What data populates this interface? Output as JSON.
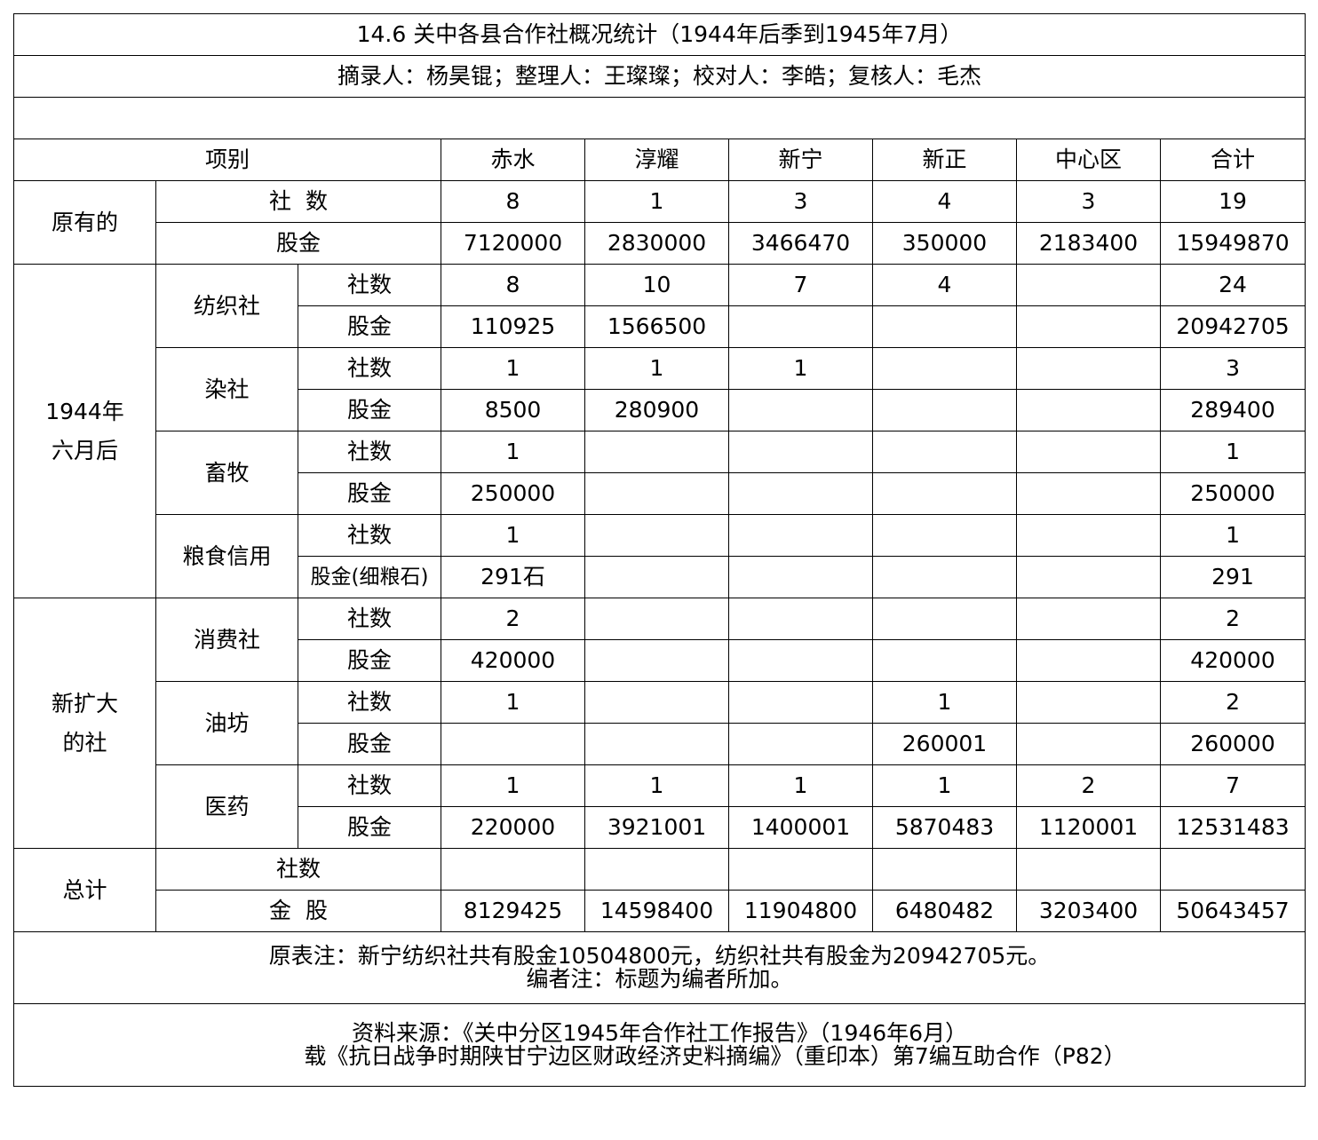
{
  "title": "14.6 关中各县合作社概况统计（1944年后季到1945年7月）",
  "credits": "摘录人：杨昊锟；整理人：王璨璨；校对人：李皓；复核人：毛杰",
  "header": {
    "item": "项别",
    "columns": [
      "赤水",
      "淳耀",
      "新宁",
      "新正",
      "中心区",
      "合计"
    ]
  },
  "groups": {
    "original": "原有的",
    "after1944": "1944年六月后",
    "new": "新扩大的社",
    "total": "总计"
  },
  "subgroups": {
    "textile": "纺织社",
    "dye": "染社",
    "livestock": "畜牧",
    "grain": "粮食信用",
    "consumer": "消费社",
    "oil": "油坊",
    "medicine": "医药"
  },
  "labels": {
    "count_spaced": "社  数",
    "count": "社数",
    "shares": "股金",
    "shares_grain": "股金(细粮石)",
    "shares_spaced": "金  股"
  },
  "rows": {
    "original_count": [
      "8",
      "1",
      "3",
      "4",
      "3",
      "19"
    ],
    "original_shares": [
      "7120000",
      "2830000",
      "3466470",
      "350000",
      "2183400",
      "15949870"
    ],
    "textile_count": [
      "8",
      "10",
      "7",
      "4",
      "",
      "24"
    ],
    "textile_shares": [
      "110925",
      "1566500",
      "",
      "",
      "",
      "20942705"
    ],
    "dye_count": [
      "1",
      "1",
      "1",
      "",
      "",
      "3"
    ],
    "dye_shares": [
      "8500",
      "280900",
      "",
      "",
      "",
      "289400"
    ],
    "livestock_count": [
      "1",
      "",
      "",
      "",
      "",
      "1"
    ],
    "livestock_shares": [
      "250000",
      "",
      "",
      "",
      "",
      "250000"
    ],
    "grain_count": [
      "1",
      "",
      "",
      "",
      "",
      "1"
    ],
    "grain_shares": [
      "291石",
      "",
      "",
      "",
      "",
      "291"
    ],
    "consumer_count": [
      "2",
      "",
      "",
      "",
      "",
      "2"
    ],
    "consumer_shares": [
      "420000",
      "",
      "",
      "",
      "",
      "420000"
    ],
    "oil_count": [
      "1",
      "",
      "",
      "1",
      "",
      "2"
    ],
    "oil_shares": [
      "",
      "",
      "",
      "260001",
      "",
      "260000"
    ],
    "medicine_count": [
      "1",
      "1",
      "1",
      "1",
      "2",
      "7"
    ],
    "medicine_shares": [
      "220000",
      "3921001",
      "1400001",
      "5870483",
      "1120001",
      "12531483"
    ],
    "total_count": [
      "",
      "",
      "",
      "",
      "",
      ""
    ],
    "total_shares": [
      "8129425",
      "14598400",
      "11904800",
      "6480482",
      "3203400",
      "50643457"
    ]
  },
  "notes": {
    "original_note": "原表注：新宁纺织社共有股金10504800元，纺织社共有股金为20942705元。",
    "editor_note": "编者注：标题为编者所加。"
  },
  "source": {
    "line1": "资料来源：《关中分区1945年合作社工作报告》（1946年6月）",
    "line2": "载《抗日战争时期陕甘宁边区财政经济史料摘编》（重印本）第7编互助合作（P82）"
  }
}
